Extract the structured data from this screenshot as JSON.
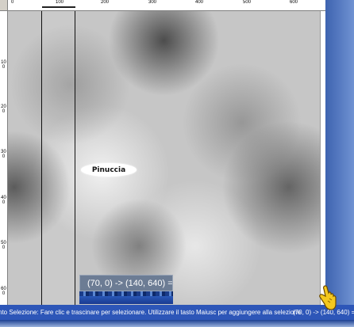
{
  "rulers": {
    "horizontal_labels": [
      "0",
      "100",
      "200",
      "300",
      "400",
      "500",
      "600"
    ],
    "vertical_labels": [
      "100",
      "200",
      "300",
      "400",
      "500",
      "600"
    ]
  },
  "canvas": {
    "watermark_text": "Pinuccia"
  },
  "selection_tooltip": {
    "text": "(70, 0) -> (140, 640) ="
  },
  "status_bar": {
    "hint_text": "nto Selezione: Fare clic e trascinare per selezionare. Utilizzare il tasto Maiusc per aggiungere alla selezione",
    "coordinates_text": "(70, 0) -> (140, 640) ="
  },
  "colors": {
    "status_bar_bg": "#2d56b8",
    "tooltip_bg": "#6c7c94"
  },
  "icons": {
    "pointer_hand": "hand-pointer-icon"
  }
}
